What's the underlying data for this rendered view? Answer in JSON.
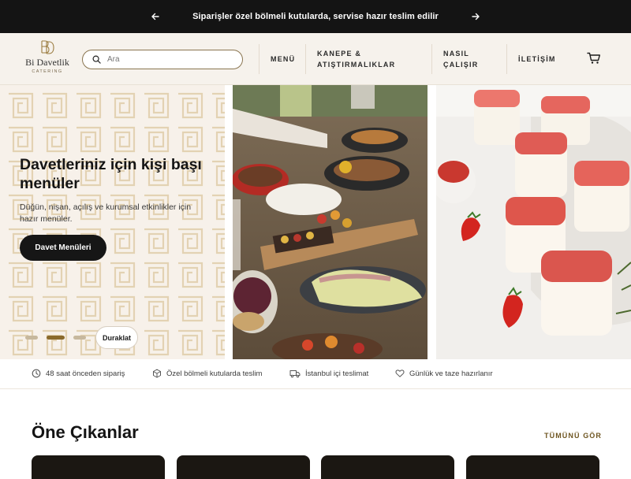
{
  "announcement": {
    "message": "Siparişler özel bölmeli kutularda, servise hazır teslim edilir",
    "prev_icon": "arrow-left-icon",
    "next_icon": "arrow-right-icon"
  },
  "header": {
    "logo": {
      "monogram": "BD",
      "brand": "Bi Davetlik",
      "sub": "CATERING"
    },
    "search_placeholder": "Ara",
    "nav": [
      {
        "label": "MENÜ"
      },
      {
        "label_line1": "KANEPE &",
        "label_line2": "ATIŞTIRMALIKLAR"
      },
      {
        "label_line1": "NASIL",
        "label_line2": "ÇALIŞIR"
      },
      {
        "label": "İLETİŞİM"
      }
    ],
    "cart_icon": "cart-icon"
  },
  "hero": {
    "title": "Davetleriniz için kişi başı menüler",
    "description": "Düğün, nişan, açılış ve kurumsal etkinlikler için hazır menüler.",
    "cta": "Davet Menüleri",
    "pause_label": "Duraklat",
    "slides_total": 3,
    "active_slide": 2
  },
  "features": [
    {
      "icon": "clock-icon",
      "text": "48 saat önceden sipariş"
    },
    {
      "icon": "box-icon",
      "text": "Özel bölmeli kutularda teslim"
    },
    {
      "icon": "truck-icon",
      "text": "İstanbul içi teslimat"
    },
    {
      "icon": "heart-icon",
      "text": "Günlük ve taze hazırlanır"
    }
  ],
  "featured": {
    "title": "Öne Çıkanlar",
    "see_all": "TÜMÜNÜ GÖR"
  },
  "colors": {
    "announcement_bg": "#141414",
    "header_bg": "#f6f2ec",
    "accent_gold": "#8a6a2c",
    "button_dark": "#161616"
  }
}
